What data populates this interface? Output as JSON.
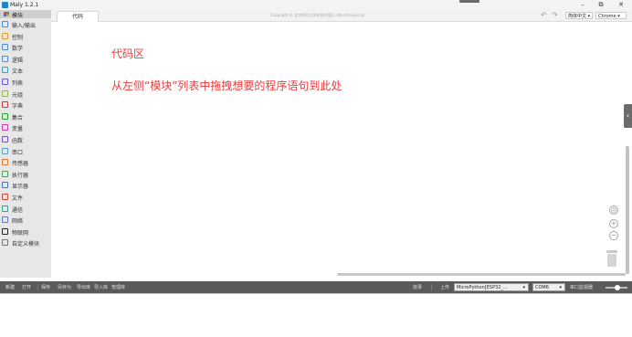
{
  "window": {
    "title": "Maly 1.2.1",
    "minimize": "–",
    "maximize": "⧉",
    "close": "✕"
  },
  "sidebar": {
    "header": "模块",
    "items": [
      {
        "label": "输入/输出",
        "color": "#4a90d9"
      },
      {
        "label": "控制",
        "color": "#e0a030"
      },
      {
        "label": "数学",
        "color": "#4a90d9"
      },
      {
        "label": "逻辑",
        "color": "#4a90d9"
      },
      {
        "label": "文本",
        "color": "#3aa0c8"
      },
      {
        "label": "列表",
        "color": "#6a5acd"
      },
      {
        "label": "元组",
        "color": "#8fbc3f"
      },
      {
        "label": "字典",
        "color": "#cc3b3b"
      },
      {
        "label": "集合",
        "color": "#2ca02c"
      },
      {
        "label": "变量",
        "color": "#cc3bb0"
      },
      {
        "label": "函数",
        "color": "#7a4fcf"
      },
      {
        "label": "串口",
        "color": "#5aa0c0"
      },
      {
        "label": "传感器",
        "color": "#e07a30"
      },
      {
        "label": "执行器",
        "color": "#3aaa55"
      },
      {
        "label": "显示器",
        "color": "#3a7ac8"
      },
      {
        "label": "文件",
        "color": "#d04a3a"
      },
      {
        "label": "通信",
        "color": "#30a0a0"
      },
      {
        "label": "网络",
        "color": "#5a7ad0"
      },
      {
        "label": "物联网",
        "color": "#222222"
      },
      {
        "label": "自定义模块",
        "color": "#777777"
      }
    ]
  },
  "tabs": {
    "code_tab": "代码"
  },
  "header": {
    "copyright": "Copyright © 北京师范大学米思齐团队 http://mixly.org/",
    "language": "简体中文",
    "browser": "Chrome"
  },
  "editor": {
    "title": "代码区",
    "hint": "从左侧“模块”列表中拖拽想要的程序语句到此处"
  },
  "toolbar": {
    "new": "新建",
    "open": "打开",
    "save": "保存",
    "save_as": "另存为",
    "export": "导出库",
    "import": "导入库",
    "manage": "管理库",
    "flash": "烧录",
    "upload": "上传",
    "board": "MicroPython[ESP32_...",
    "port": "COM6",
    "serial_monitor": "串口监视器"
  },
  "colors": {
    "code_text": "#ee3b3b",
    "bottombar": "#5a5a5a",
    "sidebar_bg": "#e7e7e7"
  }
}
